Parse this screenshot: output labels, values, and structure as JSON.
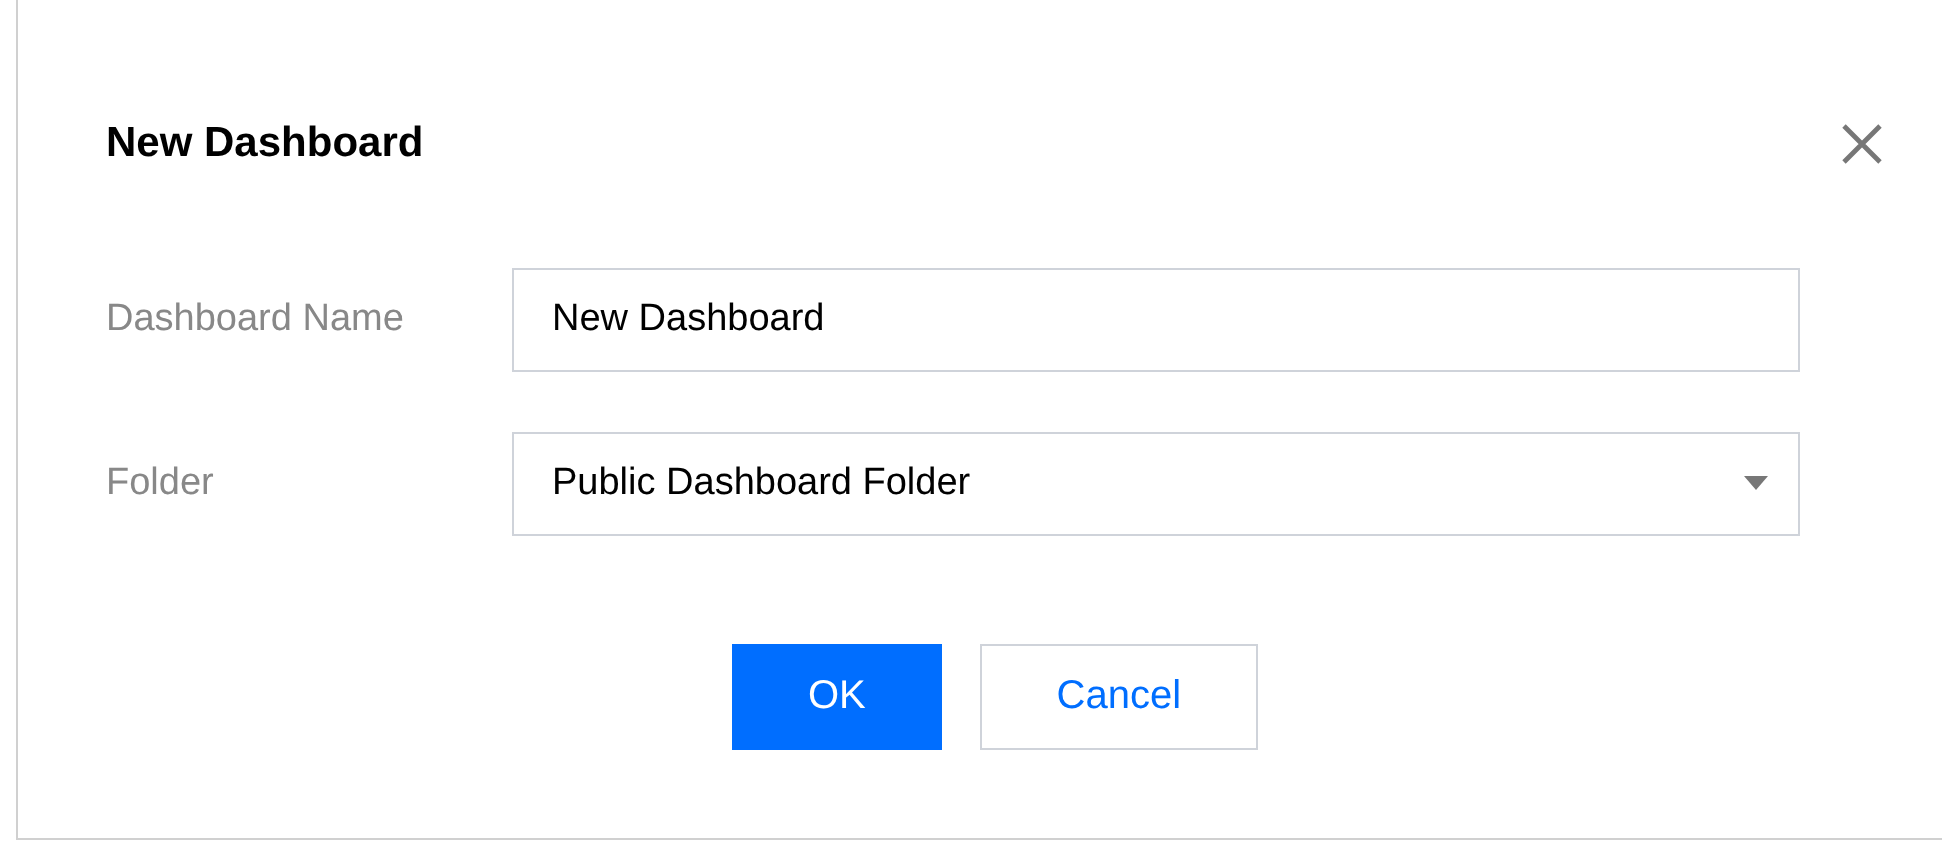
{
  "dialog": {
    "title": "New Dashboard",
    "fields": [
      {
        "kind": "text",
        "label": "Dashboard Name",
        "value": "New Dashboard"
      },
      {
        "kind": "select",
        "label": "Folder",
        "value": "Public Dashboard Folder"
      }
    ],
    "buttons": [
      {
        "label": "OK",
        "kind": "primary"
      },
      {
        "label": "Cancel",
        "kind": "secondary"
      }
    ]
  }
}
